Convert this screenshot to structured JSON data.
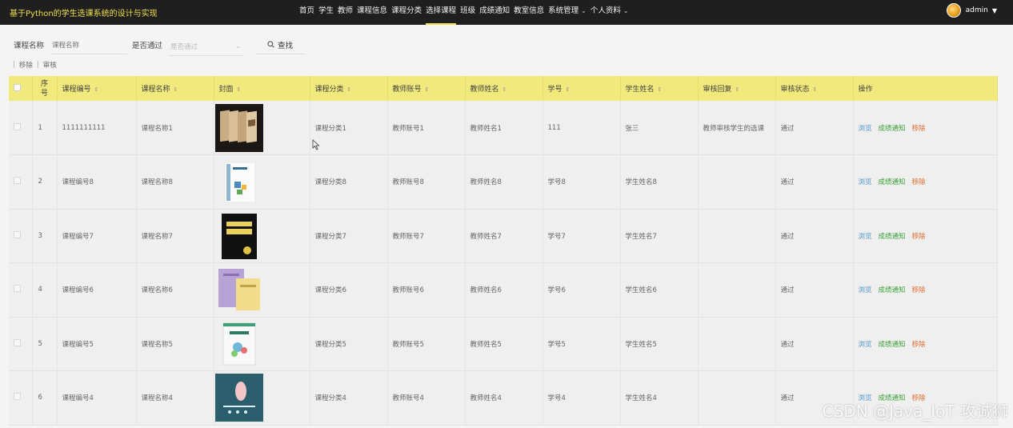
{
  "app": {
    "title": "基于Python的学生选课系统的设计与实现"
  },
  "nav": {
    "items": [
      {
        "label": "首页",
        "active": false
      },
      {
        "label": "学生",
        "active": false
      },
      {
        "label": "教师",
        "active": false
      },
      {
        "label": "课程信息",
        "active": false
      },
      {
        "label": "课程分类",
        "active": false
      },
      {
        "label": "选择课程",
        "active": true
      },
      {
        "label": "班级",
        "active": false
      },
      {
        "label": "成绩通知",
        "active": false
      },
      {
        "label": "教室信息",
        "active": false
      },
      {
        "label": "系统管理",
        "active": false,
        "dropdown": true
      },
      {
        "label": "个人资料",
        "active": false,
        "dropdown": true
      }
    ],
    "user": "admin"
  },
  "search": {
    "course_name_label": "课程名称",
    "course_name_placeholder": "课程名称",
    "passed_label": "是否通过",
    "passed_placeholder": "是否通过",
    "search_button": "查找"
  },
  "actions": {
    "remove": "移除",
    "review": "审核"
  },
  "table": {
    "columns": [
      "序号",
      "课程编号",
      "课程名称",
      "封面",
      "课程分类",
      "教师账号",
      "教师姓名",
      "学号",
      "学生姓名",
      "审核回复",
      "审核状态",
      "操作"
    ],
    "row_actions": {
      "view": "浏览",
      "notify": "成绩通知",
      "remove": "移除"
    },
    "rows": [
      {
        "index": "1",
        "course_no": "1111111111",
        "course_name": "课程名称1",
        "category": "课程分类1",
        "teacher_account": "教师账号1",
        "teacher_name": "教师姓名1",
        "student_no": "111",
        "student_name": "张三",
        "reply": "教师审核学生的选课",
        "status": "通过",
        "cover": "cover-books"
      },
      {
        "index": "2",
        "course_no": "课程编号8",
        "course_name": "课程名称8",
        "category": "课程分类8",
        "teacher_account": "教师账号8",
        "teacher_name": "教师姓名8",
        "student_no": "学号8",
        "student_name": "学生姓名8",
        "reply": "",
        "status": "通过",
        "cover": "cover-white-book"
      },
      {
        "index": "3",
        "course_no": "课程编号7",
        "course_name": "课程名称7",
        "category": "课程分类7",
        "teacher_account": "教师账号7",
        "teacher_name": "教师姓名7",
        "student_no": "学号7",
        "student_name": "学生姓名7",
        "reply": "",
        "status": "通过",
        "cover": "cover-black-book"
      },
      {
        "index": "4",
        "course_no": "课程编号6",
        "course_name": "课程名称6",
        "category": "课程分类6",
        "teacher_account": "教师账号6",
        "teacher_name": "教师姓名6",
        "student_no": "学号6",
        "student_name": "学生姓名6",
        "reply": "",
        "status": "通过",
        "cover": "cover-purple-books"
      },
      {
        "index": "5",
        "course_no": "课程编号5",
        "course_name": "课程名称5",
        "category": "课程分类5",
        "teacher_account": "教师账号5",
        "teacher_name": "教师姓名5",
        "student_no": "学号5",
        "student_name": "学生姓名5",
        "reply": "",
        "status": "通过",
        "cover": "cover-green-book"
      },
      {
        "index": "6",
        "course_no": "课程编号4",
        "course_name": "课程名称4",
        "category": "课程分类4",
        "teacher_account": "教师账号4",
        "teacher_name": "教师姓名4",
        "student_no": "学号4",
        "student_name": "学生姓名4",
        "reply": "",
        "status": "通过",
        "cover": "cover-teal-poster"
      }
    ]
  },
  "watermark": "CSDN @Java_IoT 攻诚狮"
}
